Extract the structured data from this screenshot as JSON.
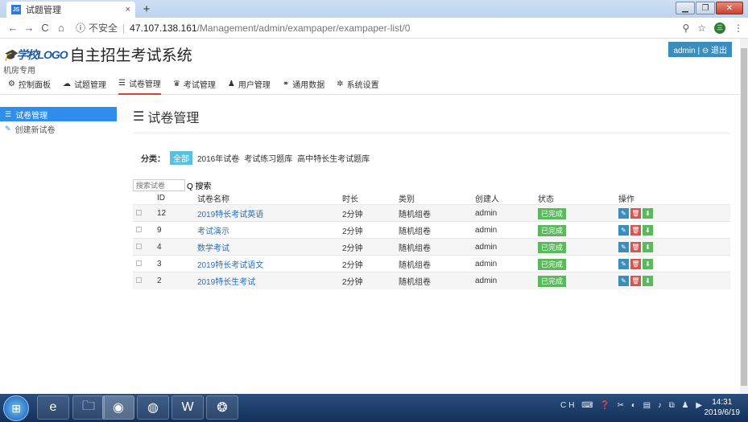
{
  "browser": {
    "tab_title": "试题管理",
    "tab_favicon": "JS",
    "tab_close": "×",
    "new_tab": "+",
    "security": "不安全",
    "host": "47.107.138.161",
    "path": "/Management/admin/exampaper/exampaper-list/0",
    "avatar": "三"
  },
  "header": {
    "logo_mark": "学校LOGO",
    "title": "自主招生考试系统",
    "subtitle": "机房专用",
    "user": "admin | ⊖ 退出"
  },
  "menu": [
    {
      "icon": "⚙",
      "label": "控制面板"
    },
    {
      "icon": "☁",
      "label": "试题管理"
    },
    {
      "icon": "☰",
      "label": "试卷管理"
    },
    {
      "icon": "♛",
      "label": "考试管理"
    },
    {
      "icon": "♟",
      "label": "用户管理"
    },
    {
      "icon": "⚭",
      "label": "通用数据"
    },
    {
      "icon": "✲",
      "label": "系统设置"
    }
  ],
  "sidebar": [
    {
      "icon": "☰",
      "label": "试卷管理"
    },
    {
      "icon": "✎",
      "label": "创建新试卷"
    }
  ],
  "main": {
    "title": "试卷管理",
    "filter_label": "分类：",
    "categories": [
      "全部",
      "2016年试卷",
      "考试练习题库",
      "高中特长生考试题库"
    ],
    "search_placeholder": "搜索试卷",
    "search_button": "Q 搜索",
    "columns": [
      "",
      "ID",
      "试卷名称",
      "时长",
      "类别",
      "创建人",
      "状态",
      "操作"
    ],
    "rows": [
      {
        "id": "12",
        "name": "2019特长考试英语",
        "duration": "2分钟",
        "type": "随机组卷",
        "creator": "admin",
        "status": "已完成"
      },
      {
        "id": "9",
        "name": "考试演示",
        "duration": "2分钟",
        "type": "随机组卷",
        "creator": "admin",
        "status": "已完成"
      },
      {
        "id": "4",
        "name": "数学考试",
        "duration": "2分钟",
        "type": "随机组卷",
        "creator": "admin",
        "status": "已完成"
      },
      {
        "id": "3",
        "name": "2019特长考试语文",
        "duration": "2分钟",
        "type": "随机组卷",
        "creator": "admin",
        "status": "已完成"
      },
      {
        "id": "2",
        "name": "2019特长生考试",
        "duration": "2分钟",
        "type": "随机组卷",
        "creator": "admin",
        "status": "已完成"
      }
    ]
  },
  "taskbar": {
    "time": "14:31",
    "date": "2019/6/19",
    "tray_label": "CH"
  },
  "colors": {
    "accent": "#2e8ded",
    "success": "#5cb85c",
    "danger": "#d9534f",
    "info": "#5bc0de"
  }
}
